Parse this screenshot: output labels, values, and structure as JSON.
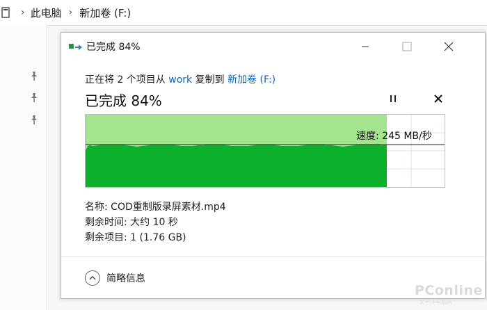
{
  "explorer": {
    "breadcrumb": [
      "此电脑",
      "新加卷 (F:)"
    ],
    "separator": "›"
  },
  "dialog": {
    "window_title": "已完成 84%",
    "status_prefix": "正在将 2 个项目从 ",
    "source": "work",
    "status_middle": " 复制到 ",
    "destination": "新加卷 (F:)",
    "headline": "已完成 84%",
    "progress_percent": 84,
    "speed_label": "速度: 245 MB/秒",
    "name_label": "名称: COD重制版录屏素材.mp4",
    "time_label": "剩余时间: 大约 10 秒",
    "items_label": "剩余项目: 1 (1.76 GB)",
    "details_label": "简略信息"
  },
  "watermark": {
    "brand": "PConline",
    "sub": "太平洋电脑网"
  },
  "colors": {
    "progress_fill": "#a4e48f",
    "graph_fill": "#0db02b",
    "link": "#0a66c2"
  }
}
